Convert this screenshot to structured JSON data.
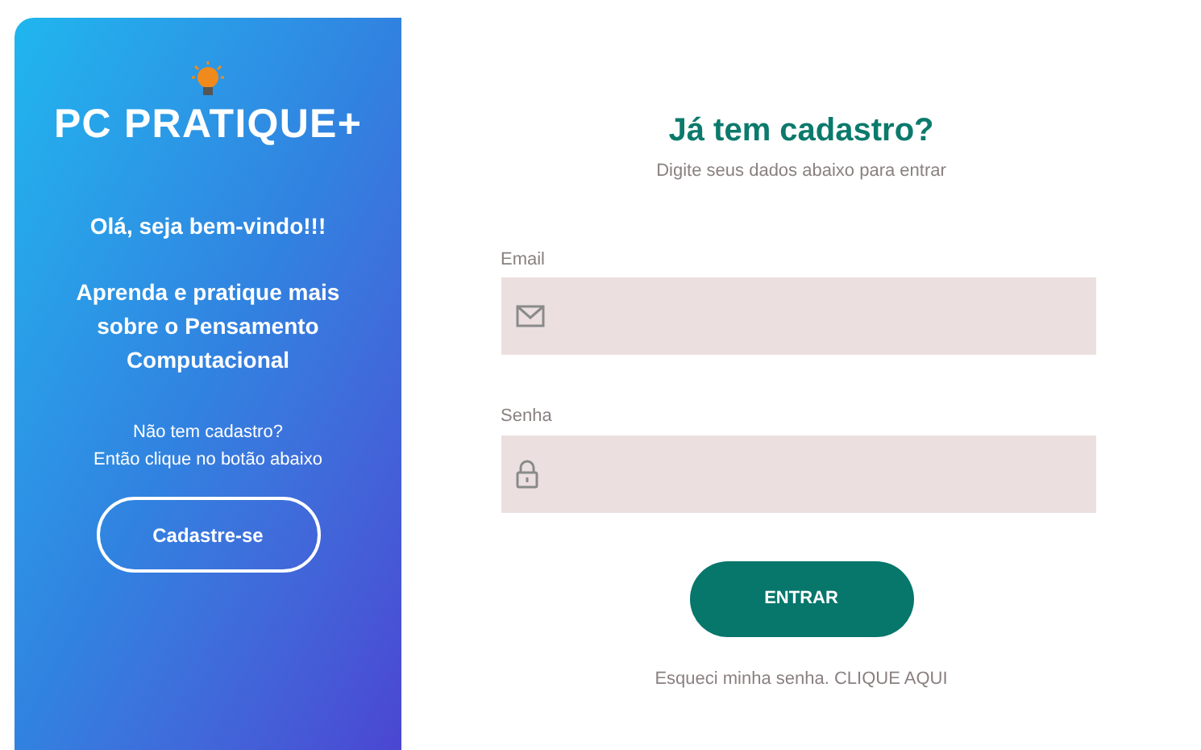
{
  "sidebar": {
    "logo": "PC PRATIQUE+",
    "greeting": "Olá, seja bem-vindo!!!",
    "tagline": "Aprenda e pratique mais sobre o Pensamento Computacional",
    "prompt_lines": [
      "Não tem cadastro?",
      "Então clique no botão abaixo"
    ],
    "signup_button": "Cadastre-se"
  },
  "form": {
    "title": "Já tem cadastro?",
    "subtitle": "Digite seus dados abaixo para entrar",
    "fields": [
      {
        "label": "Email",
        "kind": "email"
      },
      {
        "label": "Senha",
        "kind": "password"
      }
    ],
    "submit_button": "ENTRAR",
    "forgot": "Esqueci minha senha. CLIQUE AQUI"
  }
}
